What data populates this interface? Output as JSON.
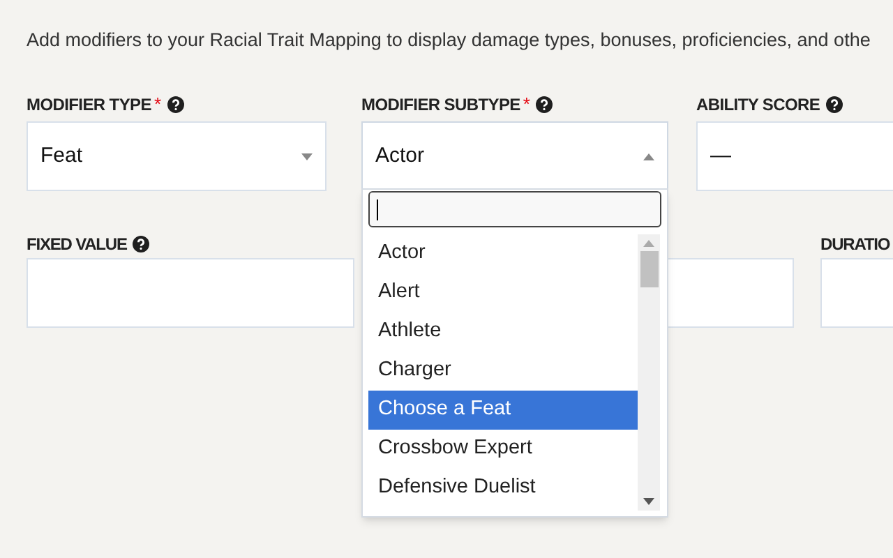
{
  "intro": "Add modifiers to your Racial Trait Mapping to display damage types, bonuses, proficiencies, and othe",
  "row_1": [
    {
      "label": "MODIFIER TYPE",
      "required_mark": "*",
      "value": "Feat",
      "kind": "select",
      "open": false
    },
    {
      "label": "MODIFIER SUBTYPE",
      "required_mark": "*",
      "value": "Actor",
      "kind": "select",
      "open": true
    },
    {
      "label": "ABILITY SCORE",
      "value": "—",
      "kind": "plain"
    }
  ],
  "row_2": [
    {
      "kind": "labeled",
      "label": "FIXED VALUE"
    },
    {
      "kind": "covered"
    },
    {
      "kind": "labeled",
      "label": "DURATIO"
    }
  ],
  "dropdown": {
    "options": [
      {
        "label": "Actor",
        "selected": false
      },
      {
        "label": "Alert",
        "selected": false
      },
      {
        "label": "Athlete",
        "selected": false
      },
      {
        "label": "Charger",
        "selected": false
      },
      {
        "label": "Choose a Feat",
        "selected": true
      },
      {
        "label": "Crossbow Expert",
        "selected": false
      },
      {
        "label": "Defensive Duelist",
        "selected": false
      }
    ]
  }
}
